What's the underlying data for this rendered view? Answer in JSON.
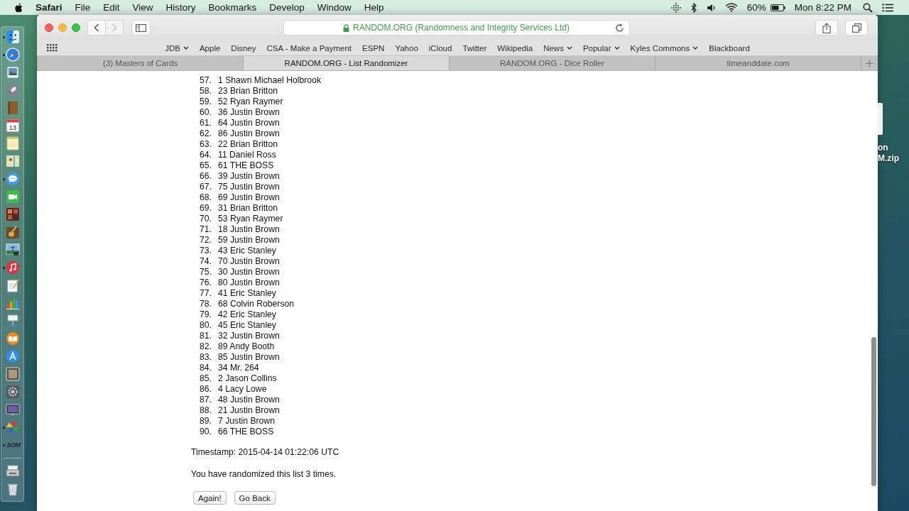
{
  "menu_bar": {
    "app_name": "Safari",
    "menus": [
      "File",
      "Edit",
      "View",
      "History",
      "Bookmarks",
      "Develop",
      "Window",
      "Help"
    ],
    "battery_percent": "60%",
    "clock": "Mon 8:22 PM"
  },
  "dock": {
    "apps": [
      {
        "kind": "finder",
        "running": true
      },
      {
        "kind": "compass",
        "running": true
      },
      {
        "kind": "preview",
        "running": false
      },
      {
        "kind": "rocket",
        "running": false
      },
      {
        "kind": "book",
        "running": false
      },
      {
        "kind": "calendar",
        "running": false,
        "label": "13"
      },
      {
        "kind": "notes",
        "running": false
      },
      {
        "kind": "map",
        "running": false
      },
      {
        "kind": "messages",
        "running": true
      },
      {
        "kind": "facetime",
        "running": false
      },
      {
        "kind": "filmstrip",
        "running": false
      },
      {
        "kind": "guitar",
        "running": false
      },
      {
        "kind": "landscape",
        "running": false
      },
      {
        "kind": "music",
        "running": true
      },
      {
        "kind": "pages",
        "running": false
      },
      {
        "kind": "chart",
        "running": false
      },
      {
        "kind": "podium",
        "running": false
      },
      {
        "kind": "books",
        "running": false
      },
      {
        "kind": "appstore",
        "running": false
      },
      {
        "kind": "picture",
        "running": false
      },
      {
        "kind": "gear",
        "running": false
      },
      {
        "kind": "monitor",
        "running": false
      },
      {
        "kind": "pinwheel",
        "running": true
      },
      {
        "kind": "wordmark",
        "running": true,
        "label": "SOM"
      }
    ],
    "extras": [
      {
        "kind": "tray"
      },
      {
        "kind": "trash"
      }
    ]
  },
  "browser": {
    "nav_buttons": [
      {
        "kind": "back",
        "disabled": false
      },
      {
        "kind": "forward",
        "disabled": true
      }
    ],
    "address": "RANDOM.ORG (Randomness and Integrity Services Ltd)",
    "secure": true,
    "bookmarks": [
      {
        "label": "JDB",
        "has_menu": true
      },
      {
        "label": "Apple",
        "has_menu": false
      },
      {
        "label": "Disney",
        "has_menu": false
      },
      {
        "label": "CSA - Make a Payment",
        "has_menu": false
      },
      {
        "label": "ESPN",
        "has_menu": false
      },
      {
        "label": "Yahoo",
        "has_menu": false
      },
      {
        "label": "iCloud",
        "has_menu": false
      },
      {
        "label": "Twitter",
        "has_menu": false
      },
      {
        "label": "Wikipedia",
        "has_menu": false
      },
      {
        "label": "News",
        "has_menu": true
      },
      {
        "label": "Popular",
        "has_menu": true
      },
      {
        "label": "Kyles Commons",
        "has_menu": true
      },
      {
        "label": "Blackboard",
        "has_menu": false
      }
    ],
    "tabs": [
      {
        "label": "(3) Masters of Cards",
        "selected": false
      },
      {
        "label": "RANDOM.ORG - List Randomizer",
        "selected": true
      },
      {
        "label": "RANDOM.ORG - Dice Roller",
        "selected": false
      },
      {
        "label": "timeanddate.com",
        "selected": false
      }
    ],
    "page": {
      "list": [
        {
          "number": "57.",
          "text": "1 Shawn Michael Holbrook"
        },
        {
          "number": "58.",
          "text": "23 Brian Britton"
        },
        {
          "number": "59.",
          "text": "52 Ryan Raymer"
        },
        {
          "number": "60.",
          "text": "36 Justin Brown"
        },
        {
          "number": "61.",
          "text": "64 Justin Brown"
        },
        {
          "number": "62.",
          "text": "86 Justin Brown"
        },
        {
          "number": "63.",
          "text": "22 Brian Britton"
        },
        {
          "number": "64.",
          "text": "11 Daniel Ross"
        },
        {
          "number": "65.",
          "text": "61 THE BOSS"
        },
        {
          "number": "66.",
          "text": "39 Justin Brown"
        },
        {
          "number": "67.",
          "text": "75 Justin Brown"
        },
        {
          "number": "68.",
          "text": "69 Justin Brown"
        },
        {
          "number": "69.",
          "text": "31 Brian Britton"
        },
        {
          "number": "70.",
          "text": "53 Ryan Raymer"
        },
        {
          "number": "71.",
          "text": "18 Justin Brown"
        },
        {
          "number": "72.",
          "text": "59 Justin Brown"
        },
        {
          "number": "73.",
          "text": "43 Eric Stanley"
        },
        {
          "number": "74.",
          "text": "70 Justin Brown"
        },
        {
          "number": "75.",
          "text": "30 Justin Brown"
        },
        {
          "number": "76.",
          "text": "80 Justin Brown"
        },
        {
          "number": "77.",
          "text": "41 Eric Stanley"
        },
        {
          "number": "78.",
          "text": "68 Colvin Roberson"
        },
        {
          "number": "79.",
          "text": "42 Eric Stanley"
        },
        {
          "number": "80.",
          "text": "45 Eric Stanley"
        },
        {
          "number": "81.",
          "text": "32 Justin Brown"
        },
        {
          "number": "82.",
          "text": "89 Andy Booth"
        },
        {
          "number": "83.",
          "text": "85 Justin Brown"
        },
        {
          "number": "84.",
          "text": "34 Mr. 264"
        },
        {
          "number": "85.",
          "text": "2 Jason Collins"
        },
        {
          "number": "86.",
          "text": "4 Lacy Lowe"
        },
        {
          "number": "87.",
          "text": "48 Justin Brown"
        },
        {
          "number": "88.",
          "text": "21 Justin Brown"
        },
        {
          "number": "89.",
          "text": "7 Justin Brown"
        },
        {
          "number": "90.",
          "text": "66 THE BOSS"
        }
      ],
      "timestamp": "Timestamp: 2015-04-14 01:22:06 UTC",
      "summary": "You have randomized this list 3 times.",
      "buttons": [
        "Again!",
        "Go Back"
      ]
    }
  },
  "desktop_file": {
    "label_lines": [
      "on",
      "M.zip"
    ]
  }
}
